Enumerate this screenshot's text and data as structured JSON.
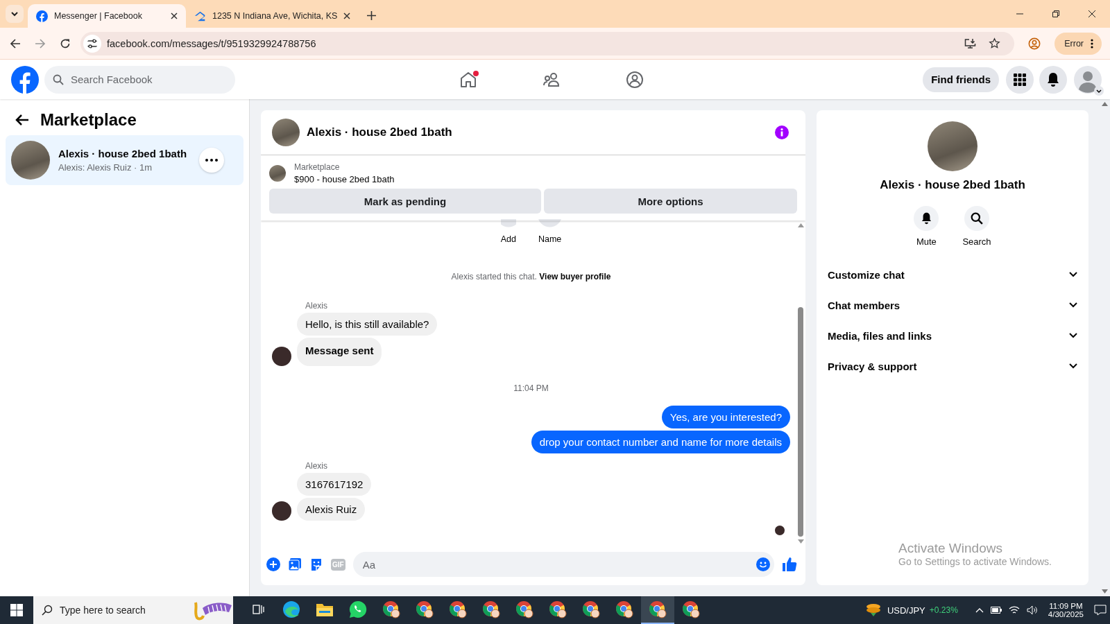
{
  "browser": {
    "tabs": [
      {
        "title": "Messenger | Facebook",
        "kind": "facebook",
        "selected": true
      },
      {
        "title": "1235 N Indiana Ave, Wichita, KS",
        "kind": "house",
        "selected": false
      }
    ],
    "url": "facebook.com/messages/t/9519329924788756",
    "profile_label": "Error"
  },
  "header": {
    "search_placeholder": "Search Facebook",
    "nav": [
      {
        "kind": "home",
        "notification": true
      },
      {
        "kind": "friends",
        "notification": false
      },
      {
        "kind": "groups",
        "notification": false
      }
    ],
    "find_friends": "Find friends"
  },
  "sidebar": {
    "title": "Marketplace",
    "conversations": [
      {
        "name": "Alexis · house 2bed 1bath",
        "preview": "Alexis: Alexis Ruiz · 1m",
        "selected": true
      }
    ]
  },
  "chat": {
    "title": "Alexis · house 2bed 1bath",
    "listing": {
      "source": "Marketplace",
      "price_title": "$900 - house 2bed 1bath"
    },
    "listing_buttons": [
      "Mark as pending",
      "More options"
    ],
    "actions": [
      {
        "label": "Add"
      },
      {
        "label": "Name"
      }
    ],
    "messages": [
      {
        "kind": "system",
        "text": "Alexis started this chat.",
        "link": "View buyer profile"
      },
      {
        "kind": "sender",
        "text": "Alexis"
      },
      {
        "kind": "incoming",
        "text": "Hello, is this still available?",
        "avatar": false,
        "bold": false
      },
      {
        "kind": "incoming",
        "text": "Message sent",
        "avatar": true,
        "bold": true
      },
      {
        "kind": "time",
        "text": "11:04 PM"
      },
      {
        "kind": "outgoing",
        "text": "Yes, are you interested?"
      },
      {
        "kind": "outgoing",
        "text": "drop your contact number and name for more details"
      },
      {
        "kind": "sender",
        "text": "Alexis"
      },
      {
        "kind": "incoming",
        "text": "3167617192",
        "avatar": false,
        "bold": false
      },
      {
        "kind": "incoming",
        "text": "Alexis Ruiz",
        "avatar": true,
        "bold": false
      }
    ],
    "composer": {
      "placeholder": "Aa",
      "gif_label": "GIF"
    }
  },
  "details": {
    "name": "Alexis · house 2bed 1bath",
    "actions": [
      {
        "kind": "mute",
        "label": "Mute"
      },
      {
        "kind": "search",
        "label": "Search"
      }
    ],
    "sections": [
      {
        "label": "Customize chat",
        "expanded": false
      },
      {
        "label": "Chat members",
        "expanded": false
      },
      {
        "label": "Media, files and links",
        "expanded": false
      },
      {
        "label": "Privacy & support",
        "expanded": false
      }
    ],
    "watermark_title": "Activate Windows",
    "watermark_text": "Go to Settings to activate Windows."
  },
  "taskbar": {
    "search_placeholder": "Type here to search",
    "apps": [
      {
        "kind": "taskview",
        "selected": false
      },
      {
        "kind": "edge",
        "selected": false
      },
      {
        "kind": "explorer",
        "selected": false
      },
      {
        "kind": "whatsapp",
        "selected": false
      },
      {
        "kind": "chrome",
        "selected": false
      },
      {
        "kind": "chrome",
        "selected": false
      },
      {
        "kind": "chrome",
        "selected": false
      },
      {
        "kind": "chrome",
        "selected": false
      },
      {
        "kind": "chrome",
        "selected": false
      },
      {
        "kind": "chrome",
        "selected": false
      },
      {
        "kind": "chrome",
        "selected": false
      },
      {
        "kind": "chrome",
        "selected": false
      },
      {
        "kind": "chrome",
        "selected": true
      },
      {
        "kind": "chrome",
        "selected": false
      }
    ],
    "ticker": {
      "symbol": "USD/JPY",
      "change": "+0.23%"
    },
    "time": "11:09 PM",
    "date": "4/30/2025"
  }
}
